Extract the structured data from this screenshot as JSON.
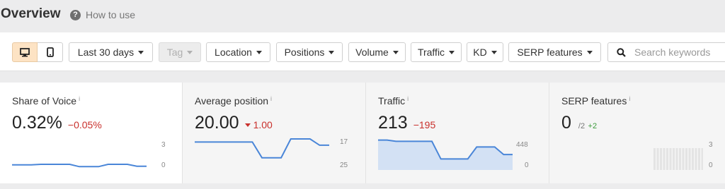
{
  "header": {
    "title": "Overview",
    "help_icon_glyph": "?",
    "help_label": "How to use"
  },
  "toolbar": {
    "device_buttons": [
      {
        "icon": "desktop-icon",
        "active": true
      },
      {
        "icon": "mobile-icon",
        "active": false
      }
    ],
    "filters": [
      {
        "label": "Last 30 days",
        "disabled": false
      },
      {
        "label": "Tag",
        "disabled": true
      },
      {
        "label": "Location",
        "disabled": false
      },
      {
        "label": "Positions",
        "disabled": false
      },
      {
        "label": "Volume",
        "disabled": false
      },
      {
        "label": "Traffic",
        "disabled": false
      },
      {
        "label": "KD",
        "disabled": false
      },
      {
        "label": "SERP features",
        "disabled": false
      }
    ],
    "search_placeholder": "Search keywords"
  },
  "metrics": {
    "share_of_voice": {
      "label": "Share of Voice",
      "info": "i",
      "value": "0.32%",
      "delta": "−0.05%",
      "y_top": "3",
      "y_bottom": "0",
      "series": [
        0.25,
        0.25,
        0.25,
        0.3,
        0.3,
        0.3,
        0.3,
        0.05,
        0.05,
        0.05,
        0.3,
        0.3,
        0.3,
        0.1,
        0.1
      ],
      "line_color": "#4a86d8"
    },
    "average_position": {
      "label": "Average position",
      "info": "i",
      "value": "20.00",
      "delta": "1.00",
      "y_top": "17",
      "y_bottom": "25",
      "series": [
        17,
        17,
        17,
        17,
        17,
        17,
        17,
        22,
        22,
        22,
        16,
        16,
        16,
        18,
        18
      ],
      "line_color": "#4a86d8"
    },
    "traffic": {
      "label": "Traffic",
      "info": "i",
      "value": "213",
      "delta": "−195",
      "y_top": "448",
      "y_bottom": "0",
      "series": [
        430,
        430,
        410,
        410,
        410,
        410,
        410,
        130,
        130,
        130,
        130,
        320,
        320,
        320,
        200,
        200
      ],
      "line_color": "#4a86d8",
      "fill_color": "#d3e1f4"
    },
    "serp_features": {
      "label": "SERP features",
      "info": "i",
      "value": "0",
      "total": "/2",
      "delta": "+2",
      "y_top": "3",
      "y_bottom": "0",
      "bar_count": 16,
      "bar_color": "#e4e4e4"
    }
  }
}
